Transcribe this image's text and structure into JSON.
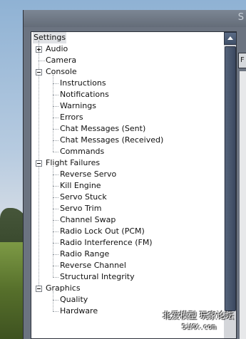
{
  "window": {
    "title_fragment": "S",
    "right_tab_fragment": "F"
  },
  "tree": {
    "root": "Settings",
    "nodes": [
      {
        "label": "Audio",
        "level": 1,
        "expander": "plus"
      },
      {
        "label": "Camera",
        "level": 1,
        "expander": null
      },
      {
        "label": "Console",
        "level": 1,
        "expander": "minus"
      },
      {
        "label": "Instructions",
        "level": 2,
        "expander": null
      },
      {
        "label": "Notifications",
        "level": 2,
        "expander": null
      },
      {
        "label": "Warnings",
        "level": 2,
        "expander": null
      },
      {
        "label": "Errors",
        "level": 2,
        "expander": null
      },
      {
        "label": "Chat Messages (Sent)",
        "level": 2,
        "expander": null
      },
      {
        "label": "Chat Messages (Received)",
        "level": 2,
        "expander": null
      },
      {
        "label": "Commands",
        "level": 2,
        "expander": null
      },
      {
        "label": "Flight Failures",
        "level": 1,
        "expander": "minus"
      },
      {
        "label": "Reverse Servo",
        "level": 2,
        "expander": null
      },
      {
        "label": "Kill Engine",
        "level": 2,
        "expander": null
      },
      {
        "label": "Servo Stuck",
        "level": 2,
        "expander": null
      },
      {
        "label": "Servo Trim",
        "level": 2,
        "expander": null
      },
      {
        "label": "Channel Swap",
        "level": 2,
        "expander": null
      },
      {
        "label": "Radio Lock Out (PCM)",
        "level": 2,
        "expander": null
      },
      {
        "label": "Radio Interference (FM)",
        "level": 2,
        "expander": null
      },
      {
        "label": "Radio Range",
        "level": 2,
        "expander": null
      },
      {
        "label": "Reverse Channel",
        "level": 2,
        "expander": null
      },
      {
        "label": "Structural Integrity",
        "level": 2,
        "expander": null
      },
      {
        "label": "Graphics",
        "level": 1,
        "expander": "minus"
      },
      {
        "label": "Quality",
        "level": 2,
        "expander": null
      },
      {
        "label": "Hardware",
        "level": 2,
        "expander": null
      }
    ]
  },
  "icons": {
    "scroll_up": "chevron-up-icon",
    "expand": "plus-box-icon",
    "collapse": "minus-box-icon"
  },
  "colors": {
    "window_frame": "#6b7380",
    "scroll_thumb": "#46546b",
    "tree_background": "#ffffff"
  },
  "watermark": {
    "line1": "北爱模型 玩家论坛",
    "line2": "5iMX.com"
  }
}
